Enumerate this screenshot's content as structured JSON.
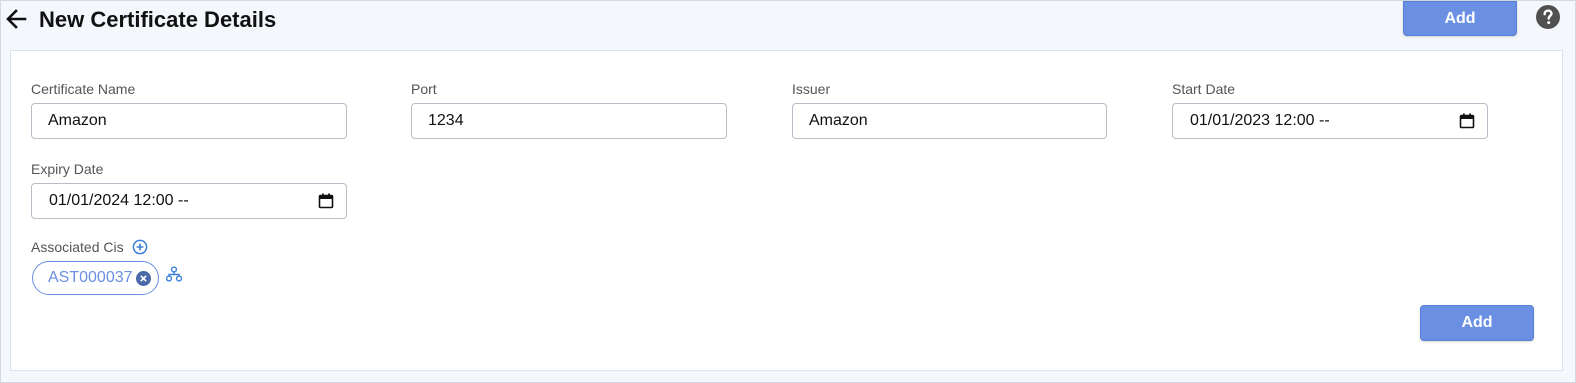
{
  "header": {
    "title": "New Certificate Details",
    "add_label": "Add",
    "back_icon": "arrow-left-icon",
    "help_icon": "question-circle-icon"
  },
  "form": {
    "certificate_name": {
      "label": "Certificate Name",
      "value": "Amazon"
    },
    "port": {
      "label": "Port",
      "value": "1234"
    },
    "issuer": {
      "label": "Issuer",
      "value": "Amazon"
    },
    "start_date": {
      "label": "Start Date",
      "value": "01/01/2023 12:00 --"
    },
    "expiry_date": {
      "label": "Expiry Date",
      "value": "01/01/2024 12:00 --"
    },
    "associated_cis": {
      "label": "Associated Cis",
      "chips": [
        {
          "label": "AST000037"
        }
      ]
    }
  },
  "footer": {
    "add_label": "Add"
  },
  "colors": {
    "accent": "#6a8fe3",
    "border": "#b8bec8",
    "background": "#f4f7fc"
  }
}
